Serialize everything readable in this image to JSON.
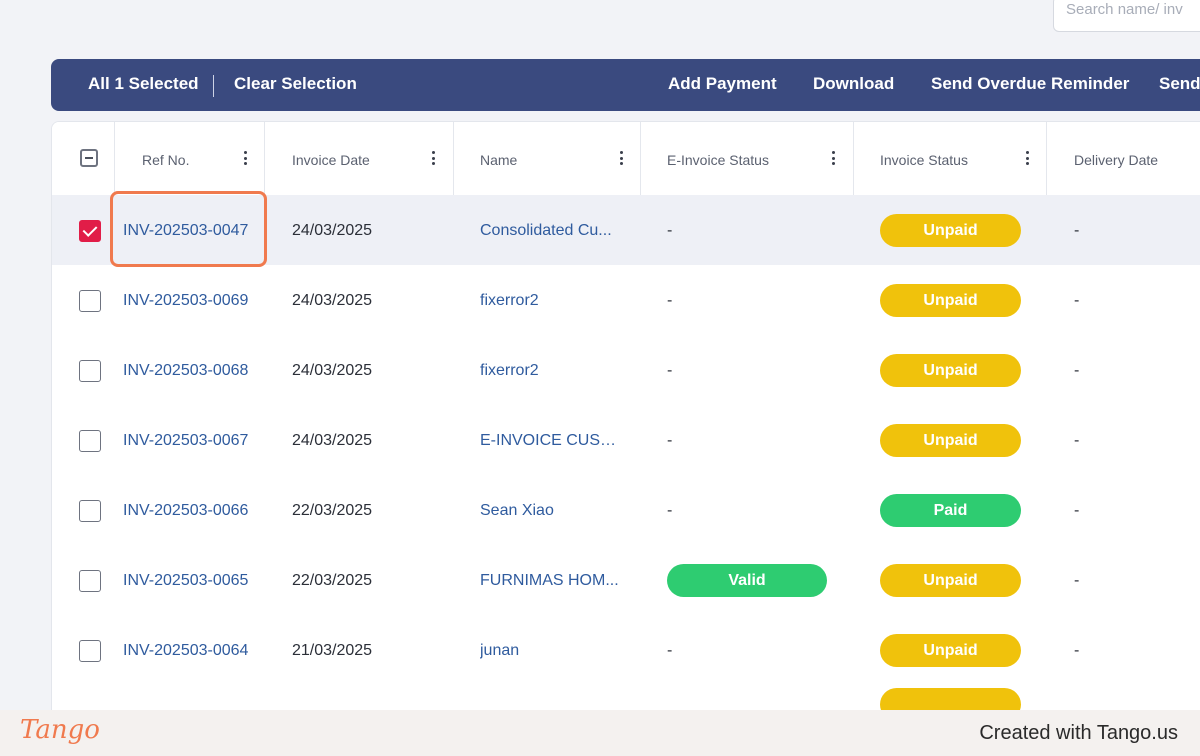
{
  "search": {
    "placeholder": "Search name/ inv"
  },
  "toolbar": {
    "selected_label": "All 1 Selected",
    "clear_label": "Clear Selection",
    "add_payment_label": "Add Payment",
    "download_label": "Download",
    "overdue_label": "Send Overdue Reminder",
    "send_label": "Send"
  },
  "columns": {
    "ref": "Ref No.",
    "date": "Invoice Date",
    "name": "Name",
    "einvoice": "E-Invoice Status",
    "status": "Invoice Status",
    "delivery": "Delivery Date"
  },
  "rows": [
    {
      "ref": "INV-202503-0047",
      "date": "24/03/2025",
      "name": "Consolidated Cu...",
      "einvoice": "-",
      "status": "Unpaid",
      "delivery": "-",
      "checked": true
    },
    {
      "ref": "INV-202503-0069",
      "date": "24/03/2025",
      "name": "fixerror2",
      "einvoice": "-",
      "status": "Unpaid",
      "delivery": "-",
      "checked": false
    },
    {
      "ref": "INV-202503-0068",
      "date": "24/03/2025",
      "name": "fixerror2",
      "einvoice": "-",
      "status": "Unpaid",
      "delivery": "-",
      "checked": false
    },
    {
      "ref": "INV-202503-0067",
      "date": "24/03/2025",
      "name": "E-INVOICE CUST...",
      "einvoice": "-",
      "status": "Unpaid",
      "delivery": "-",
      "checked": false
    },
    {
      "ref": "INV-202503-0066",
      "date": "22/03/2025",
      "name": "Sean Xiao",
      "einvoice": "-",
      "status": "Paid",
      "delivery": "-",
      "checked": false
    },
    {
      "ref": "INV-202503-0065",
      "date": "22/03/2025",
      "name": "FURNIMAS HOM...",
      "einvoice": "Valid",
      "status": "Unpaid",
      "delivery": "-",
      "checked": false
    },
    {
      "ref": "INV-202503-0064",
      "date": "21/03/2025",
      "name": "junan",
      "einvoice": "-",
      "status": "Unpaid",
      "delivery": "-",
      "checked": false
    }
  ],
  "footer": {
    "logo_text": "Tango",
    "credit": "Created with Tango.us"
  },
  "colors": {
    "toolbar_bg": "#3a4a7f",
    "unpaid": "#f0c20c",
    "paid": "#2ecc71",
    "link": "#2f5b9e",
    "checkbox_checked": "#e11d48",
    "highlight": "#f07a4e"
  }
}
